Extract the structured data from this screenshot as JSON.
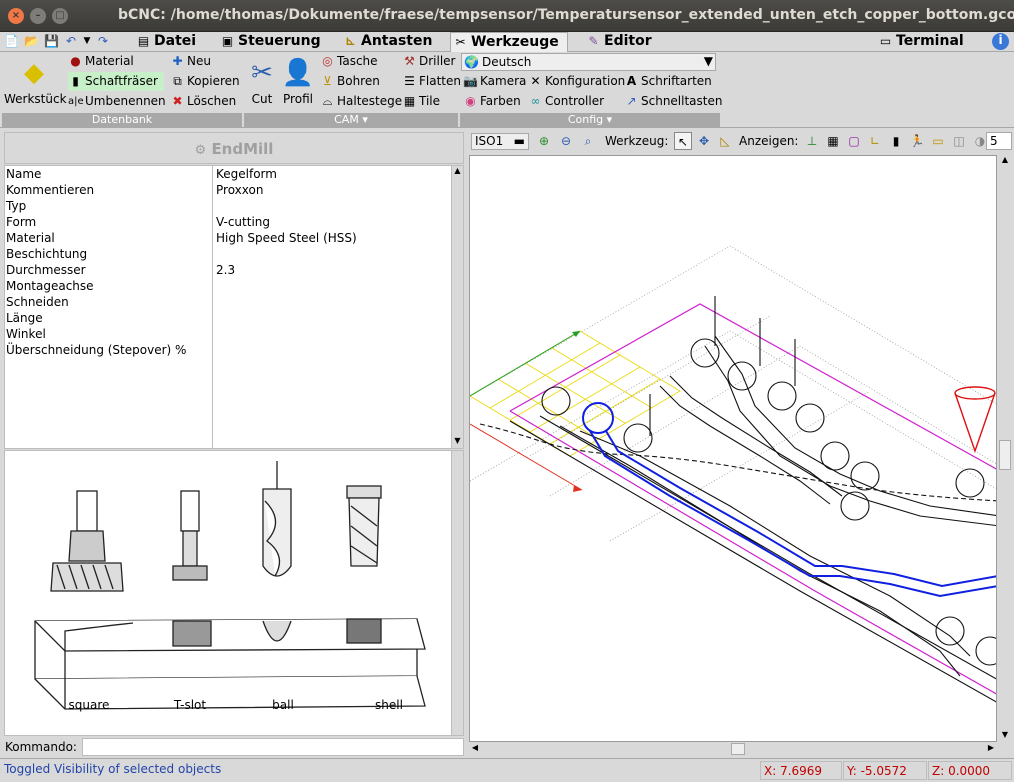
{
  "window": {
    "title": "bCNC: /home/thomas/Dokumente/fraese/tempsensor/Temperatursensor_extended_unten_etch_copper_bottom.gcode"
  },
  "tabs": [
    {
      "label": "Datei"
    },
    {
      "label": "Steuerung"
    },
    {
      "label": "Antasten"
    },
    {
      "label": "Werkzeuge"
    },
    {
      "label": "Editor"
    },
    {
      "label": "Terminal"
    }
  ],
  "ribbon": {
    "datenbank": {
      "label": "Datenbank",
      "werkstueck": "Werkstück",
      "material": "Material",
      "schaftfraeser": "Schaftfräser",
      "umbenennen": "Umbenennen",
      "neu": "Neu",
      "kopieren": "Kopieren",
      "loeschen": "Löschen"
    },
    "cam": {
      "label": "CAM",
      "cut": "Cut",
      "profil": "Profil",
      "tasche": "Tasche",
      "bohren": "Bohren",
      "haltestege": "Haltestege",
      "driller": "Driller",
      "flatten": "Flatten",
      "tile": "Tile"
    },
    "config": {
      "label": "Config",
      "language": "Deutsch",
      "kamera": "Kamera",
      "konfiguration": "Konfiguration",
      "schriftarten": "Schriftarten",
      "farben": "Farben",
      "controller": "Controller",
      "schnelltasten": "Schnelltasten"
    }
  },
  "endmill": {
    "header": "EndMill",
    "labels": [
      "Name",
      "Kommentieren",
      "Typ",
      "Form",
      "Material",
      "Beschichtung",
      "Durchmesser",
      "Montageachse",
      "Schneiden",
      "Länge",
      "Winkel",
      "Überschneidung (Stepover) %"
    ],
    "values": [
      "Kegelform",
      "Proxxon",
      "",
      "V-cutting",
      "High Speed Steel (HSS)",
      "",
      "2.3",
      "",
      "",
      "",
      "",
      ""
    ],
    "image_captions": [
      "square",
      "T-slot",
      "ball",
      "shell"
    ]
  },
  "command": {
    "label": "Kommando:",
    "value": ""
  },
  "view_toolbar": {
    "projection": "ISO1",
    "werkzeug_label": "Werkzeug:",
    "anzeigen_label": "Anzeigen:",
    "count": "5"
  },
  "status": {
    "message": "Toggled Visibility of selected objects",
    "x": "X: 7.6969",
    "y": "Y: -5.0572",
    "z": "Z: 0.0000"
  }
}
